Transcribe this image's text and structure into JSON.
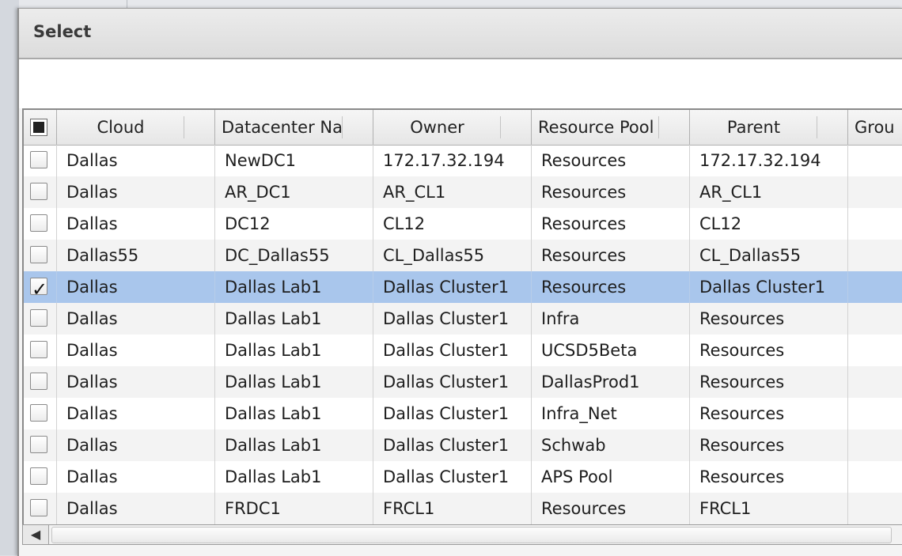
{
  "dialog": {
    "title": "Select"
  },
  "grid": {
    "columns": [
      "Cloud",
      "Datacenter Na",
      "Owner",
      "Resource Pool",
      "Parent",
      "Grou"
    ],
    "rows": [
      {
        "checked": false,
        "cells": [
          "Dallas",
          "NewDC1",
          "172.17.32.194",
          "Resources",
          "172.17.32.194",
          ""
        ]
      },
      {
        "checked": false,
        "cells": [
          "Dallas",
          "AR_DC1",
          "AR_CL1",
          "Resources",
          "AR_CL1",
          ""
        ]
      },
      {
        "checked": false,
        "cells": [
          "Dallas",
          "DC12",
          "CL12",
          "Resources",
          "CL12",
          ""
        ]
      },
      {
        "checked": false,
        "cells": [
          "Dallas55",
          "DC_Dallas55",
          "CL_Dallas55",
          "Resources",
          "CL_Dallas55",
          ""
        ]
      },
      {
        "checked": true,
        "cells": [
          "Dallas",
          "Dallas Lab1",
          "Dallas Cluster1",
          "Resources",
          "Dallas Cluster1",
          ""
        ]
      },
      {
        "checked": false,
        "cells": [
          "Dallas",
          "Dallas Lab1",
          "Dallas Cluster1",
          "Infra",
          "Resources",
          ""
        ]
      },
      {
        "checked": false,
        "cells": [
          "Dallas",
          "Dallas Lab1",
          "Dallas Cluster1",
          "UCSD5Beta",
          "Resources",
          ""
        ]
      },
      {
        "checked": false,
        "cells": [
          "Dallas",
          "Dallas Lab1",
          "Dallas Cluster1",
          "DallasProd1",
          "Resources",
          ""
        ]
      },
      {
        "checked": false,
        "cells": [
          "Dallas",
          "Dallas Lab1",
          "Dallas Cluster1",
          "Infra_Net",
          "Resources",
          ""
        ]
      },
      {
        "checked": false,
        "cells": [
          "Dallas",
          "Dallas Lab1",
          "Dallas Cluster1",
          "Schwab",
          "Resources",
          ""
        ]
      },
      {
        "checked": false,
        "cells": [
          "Dallas",
          "Dallas Lab1",
          "Dallas Cluster1",
          "APS Pool",
          "Resources",
          ""
        ]
      },
      {
        "checked": false,
        "cells": [
          "Dallas",
          "FRDC1",
          "FRCL1",
          "Resources",
          "FRCL1",
          ""
        ]
      }
    ]
  },
  "scrollbar": {
    "left_arrow": "◀"
  },
  "colors": {
    "selected_row": "#a9c6ec",
    "alt_row": "#f3f3f3"
  }
}
